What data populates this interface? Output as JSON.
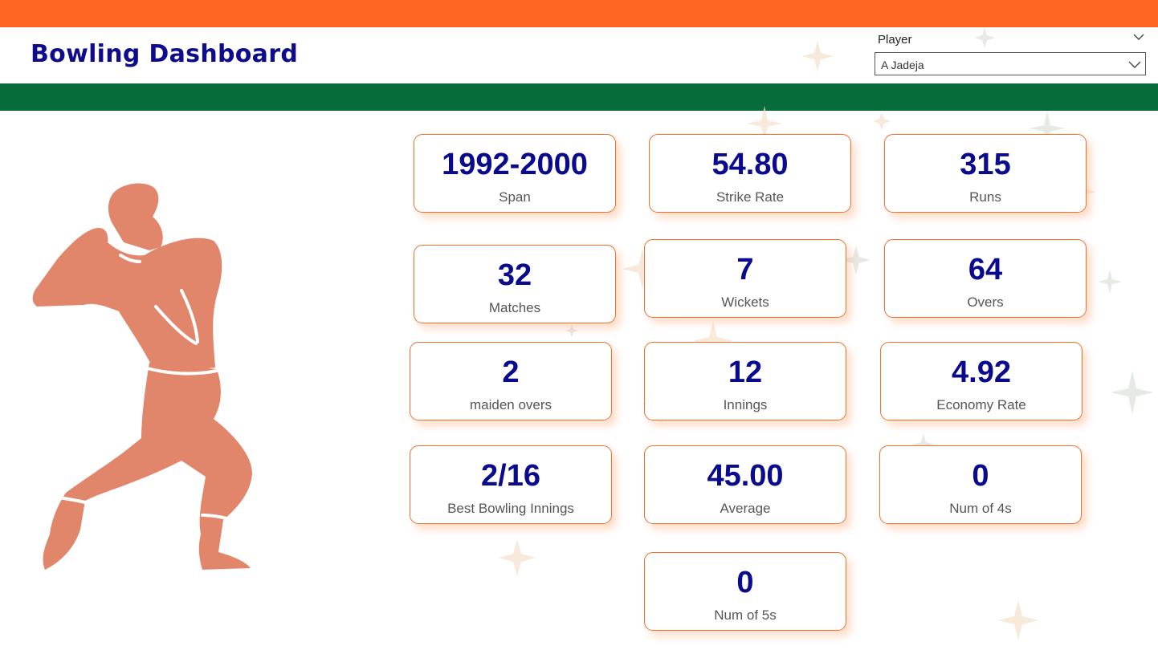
{
  "header": {
    "title": "Bowling Dashboard"
  },
  "filter": {
    "label": "Player",
    "selected": "A Jadeja"
  },
  "colors": {
    "top_band": "#ff6721",
    "green_band": "#066d3a",
    "title": "#0e0c8c",
    "value": "#0a0a8e",
    "card_border": "#f0702c",
    "figure": "#e2866b"
  },
  "icons": {
    "collapse": "chevron-down-icon",
    "dropdown": "chevron-down-icon",
    "figure": "cricket-bowler-illustration",
    "decoration": "sparkle-icon"
  },
  "cards": [
    {
      "label": "Span",
      "value": "1992-2000"
    },
    {
      "label": "Strike Rate",
      "value": "54.80"
    },
    {
      "label": "Runs",
      "value": "315"
    },
    {
      "label": "Matches",
      "value": "32"
    },
    {
      "label": "Wickets",
      "value": "7"
    },
    {
      "label": "Overs",
      "value": "64"
    },
    {
      "label": "maiden overs",
      "value": "2"
    },
    {
      "label": "Innings",
      "value": "12"
    },
    {
      "label": "Economy Rate",
      "value": "4.92"
    },
    {
      "label": "Best Bowling Innings",
      "value": "2/16"
    },
    {
      "label": "Average",
      "value": "45.00"
    },
    {
      "label": "Num of 4s",
      "value": "0"
    },
    {
      "label": "Num of 5s",
      "value": "0"
    }
  ]
}
